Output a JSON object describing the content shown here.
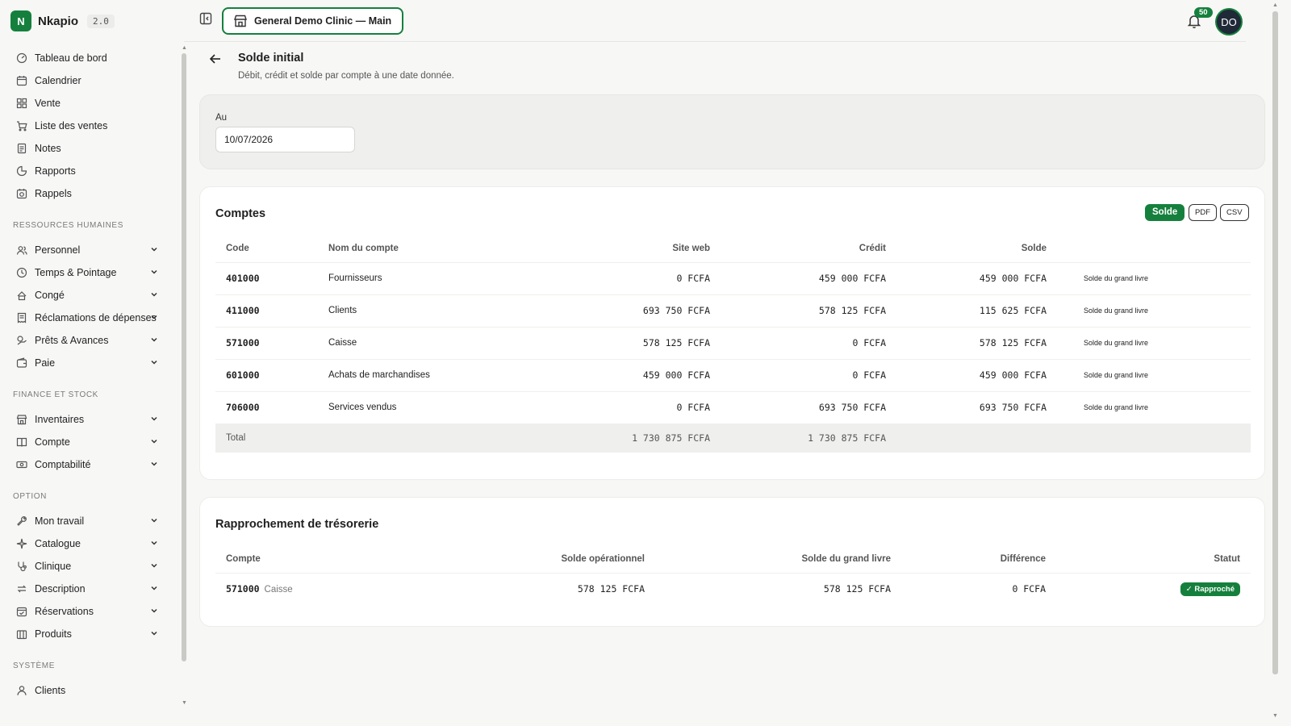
{
  "app": {
    "logo_letter": "N",
    "name": "Nkapio",
    "version": "2.0"
  },
  "topbar": {
    "clinic": "General Demo Clinic — Main",
    "notifications": "50",
    "avatar": "DO"
  },
  "nav": {
    "main": [
      {
        "label": "Tableau de bord",
        "icon": "dashboard-icon"
      },
      {
        "label": "Calendrier",
        "icon": "calendar-icon"
      },
      {
        "label": "Vente",
        "icon": "grid-icon"
      },
      {
        "label": "Liste des ventes",
        "icon": "cart-icon"
      },
      {
        "label": "Notes",
        "icon": "note-icon"
      },
      {
        "label": "Rapports",
        "icon": "pie-chart-icon"
      },
      {
        "label": "Rappels",
        "icon": "reminder-icon"
      }
    ],
    "hr_title": "RESSOURCES HUMAINES",
    "hr": [
      {
        "label": "Personnel",
        "icon": "users-icon"
      },
      {
        "label": "Temps & Pointage",
        "icon": "clock-icon"
      },
      {
        "label": "Congé",
        "icon": "leave-icon"
      },
      {
        "label": "Réclamations de dépenses",
        "icon": "receipt-icon"
      },
      {
        "label": "Prêts & Avances",
        "icon": "loan-icon"
      },
      {
        "label": "Paie",
        "icon": "wallet-icon"
      }
    ],
    "fin_title": "FINANCE ET STOCK",
    "fin": [
      {
        "label": "Inventaires",
        "icon": "store-icon"
      },
      {
        "label": "Compte",
        "icon": "book-icon"
      },
      {
        "label": "Comptabilité",
        "icon": "cash-icon"
      }
    ],
    "opt_title": "OPTION",
    "opt": [
      {
        "label": "Mon travail",
        "icon": "wrench-icon"
      },
      {
        "label": "Catalogue",
        "icon": "sparkle-icon"
      },
      {
        "label": "Clinique",
        "icon": "stethoscope-icon"
      },
      {
        "label": "Description",
        "icon": "refresh-icon"
      },
      {
        "label": "Réservations",
        "icon": "booking-icon"
      },
      {
        "label": "Produits",
        "icon": "box-icon"
      }
    ],
    "sys_title": "SYSTÈME",
    "sys": [
      {
        "label": "Clients",
        "icon": "user-icon"
      }
    ]
  },
  "page": {
    "title": "Solde initial",
    "subtitle": "Débit, crédit et solde par compte à une date donnée."
  },
  "date_filter": {
    "label": "Au",
    "value": "10/07/2026"
  },
  "accounts": {
    "title": "Comptes",
    "buttons": {
      "solde": "Solde",
      "pdf": "PDF",
      "csv": "CSV"
    },
    "headers": [
      "Code",
      "Nom du compte",
      "Site web",
      "Crédit",
      "Solde"
    ],
    "rows": [
      {
        "code": "401000",
        "name": "Fournisseurs",
        "debit": "0 FCFA",
        "credit": "459 000 FCFA",
        "balance": "459 000 FCFA",
        "note": "Solde du grand livre"
      },
      {
        "code": "411000",
        "name": "Clients",
        "debit": "693 750 FCFA",
        "credit": "578 125 FCFA",
        "balance": "115 625 FCFA",
        "note": "Solde du grand livre"
      },
      {
        "code": "571000",
        "name": "Caisse",
        "debit": "578 125 FCFA",
        "credit": "0 FCFA",
        "balance": "578 125 FCFA",
        "note": "Solde du grand livre"
      },
      {
        "code": "601000",
        "name": "Achats de marchandises",
        "debit": "459 000 FCFA",
        "credit": "0 FCFA",
        "balance": "459 000 FCFA",
        "note": "Solde du grand livre"
      },
      {
        "code": "706000",
        "name": "Services vendus",
        "debit": "0 FCFA",
        "credit": "693 750 FCFA",
        "balance": "693 750 FCFA",
        "note": "Solde du grand livre"
      }
    ],
    "total": {
      "label": "Total",
      "debit": "1 730 875 FCFA",
      "credit": "1 730 875 FCFA"
    }
  },
  "reconciliation": {
    "title": "Rapprochement de trésorerie",
    "headers": [
      "Compte",
      "Solde opérationnel",
      "Solde du grand livre",
      "Différence",
      "Statut"
    ],
    "rows": [
      {
        "code": "571000",
        "name": "Caisse",
        "operational": "578 125 FCFA",
        "ledger": "578 125 FCFA",
        "difference": "0 FCFA",
        "status": "✓ Rapproché"
      }
    ]
  },
  "colors": {
    "accent": "#15803d",
    "background": "#f7f7f6"
  }
}
